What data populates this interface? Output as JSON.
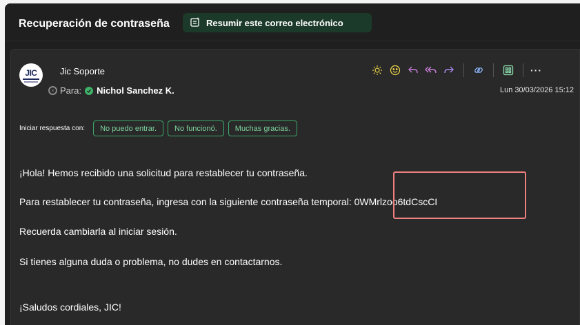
{
  "subject": "Recuperación de contraseña",
  "summarize_button": "Resumir este correo electrónico",
  "sender": {
    "avatar_text": "JIC",
    "name": "Jic Soporte",
    "to_label": "Para:",
    "recipient": "Nichol Sanchez K.",
    "date": "Lun 30/03/2026 15:12"
  },
  "toolbar": {
    "icons": [
      "sun-icon",
      "smiley-icon",
      "reply-icon",
      "reply-all-icon",
      "forward-icon",
      "link-icon",
      "apps-icon",
      "more-icon"
    ],
    "more": "···"
  },
  "quick_replies": {
    "label": "Iniciar respuesta con:",
    "options": [
      "No puedo entrar.",
      "No funcionó.",
      "Muchas gracias."
    ]
  },
  "body": {
    "line1": "¡Hola! Hemos recibido una solicitud para restablecer tu contraseña.",
    "line2": "Para restablecer tu contraseña, ingresa con la siguiente contraseña temporal: 0WMrlzoo6tdCscCI",
    "line3": "Recuerda cambiarla al iniciar sesión.",
    "line4": "Si tienes alguna duda o problema, no dudes en contactarnos.",
    "line5": "¡Saludos cordiales, JIC!"
  },
  "colors": {
    "accent_green": "#3da86c",
    "highlight": "#f08080",
    "background": "#1f1f1f"
  }
}
